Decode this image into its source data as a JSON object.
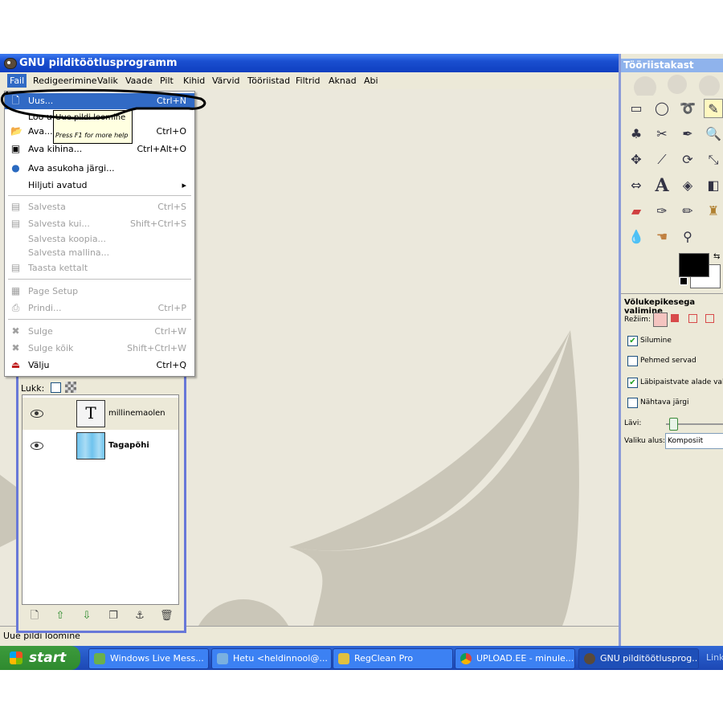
{
  "window": {
    "title": "GNU pilditöötlusprogramm"
  },
  "menubar": [
    "Fail",
    "Redigeerimine",
    "Valik",
    "Vaade",
    "Pilt",
    "Kihid",
    "Värvid",
    "Tööriistad",
    "Filtrid",
    "Aknad",
    "Abi"
  ],
  "file_menu": {
    "items": [
      {
        "label": "Uus...",
        "shortcut": "Ctrl+N"
      },
      {
        "label": "Loo uus",
        "shortcut": ""
      },
      {
        "label": "Ava...",
        "shortcut": "Ctrl+O"
      },
      {
        "label": "Ava kihina...",
        "shortcut": "Ctrl+Alt+O"
      },
      {
        "label": "Ava asukoha järgi...",
        "shortcut": ""
      },
      {
        "label": "Hiljuti avatud",
        "shortcut": "▸"
      },
      {
        "label": "Salvesta",
        "shortcut": "Ctrl+S"
      },
      {
        "label": "Salvesta kui...",
        "shortcut": "Shift+Ctrl+S"
      },
      {
        "label": "Salvesta koopia...",
        "shortcut": ""
      },
      {
        "label": "Salvesta mallina...",
        "shortcut": ""
      },
      {
        "label": "Taasta kettalt",
        "shortcut": ""
      },
      {
        "label": "Page Setup",
        "shortcut": ""
      },
      {
        "label": "Prindi...",
        "shortcut": "Ctrl+P"
      },
      {
        "label": "Sulge",
        "shortcut": "Ctrl+W"
      },
      {
        "label": "Sulge kõik",
        "shortcut": "Shift+Ctrl+W"
      },
      {
        "label": "Välju",
        "shortcut": "Ctrl+Q"
      }
    ]
  },
  "tooltip": {
    "title": "Uue pildi loomine",
    "help": "Press F1 for more help"
  },
  "statusbar": {
    "text": "Uue pildi loomine"
  },
  "layers": {
    "lock_label": "Lukk:",
    "items": [
      {
        "name": "millinemaolen"
      },
      {
        "name": "Tagapõhi"
      }
    ]
  },
  "toolbox": {
    "title": "Tööriistakast",
    "options_title": "Võlukepikesega valimine",
    "mode_label": "Režiim:",
    "options": [
      {
        "label": "Silumine",
        "checked": "✔"
      },
      {
        "label": "Pehmed servad",
        "checked": ""
      },
      {
        "label": "Läbipaistvate alade valimine",
        "checked": "✔"
      },
      {
        "label": "Nähtava järgi",
        "checked": ""
      }
    ],
    "threshold_label": "Lävi:",
    "select_by_label": "Valiku alus:",
    "select_by_value": "Komposiit"
  },
  "taskbar": {
    "start_label": "start",
    "tasks": [
      {
        "label": "Windows Live Mess..."
      },
      {
        "label": "Hetu <heldinnool@..."
      },
      {
        "label": "RegClean Pro"
      },
      {
        "label": "UPLOAD.EE - minule..."
      },
      {
        "label": "GNU pilditöötlusprog..."
      }
    ],
    "links_label": "Links"
  },
  "colors": {
    "titlebar": "#1a4fd0",
    "highlight": "#316ac5",
    "canvas": "#ebe8dc",
    "swirl": "#cac6b8",
    "annotation": "#000000"
  }
}
